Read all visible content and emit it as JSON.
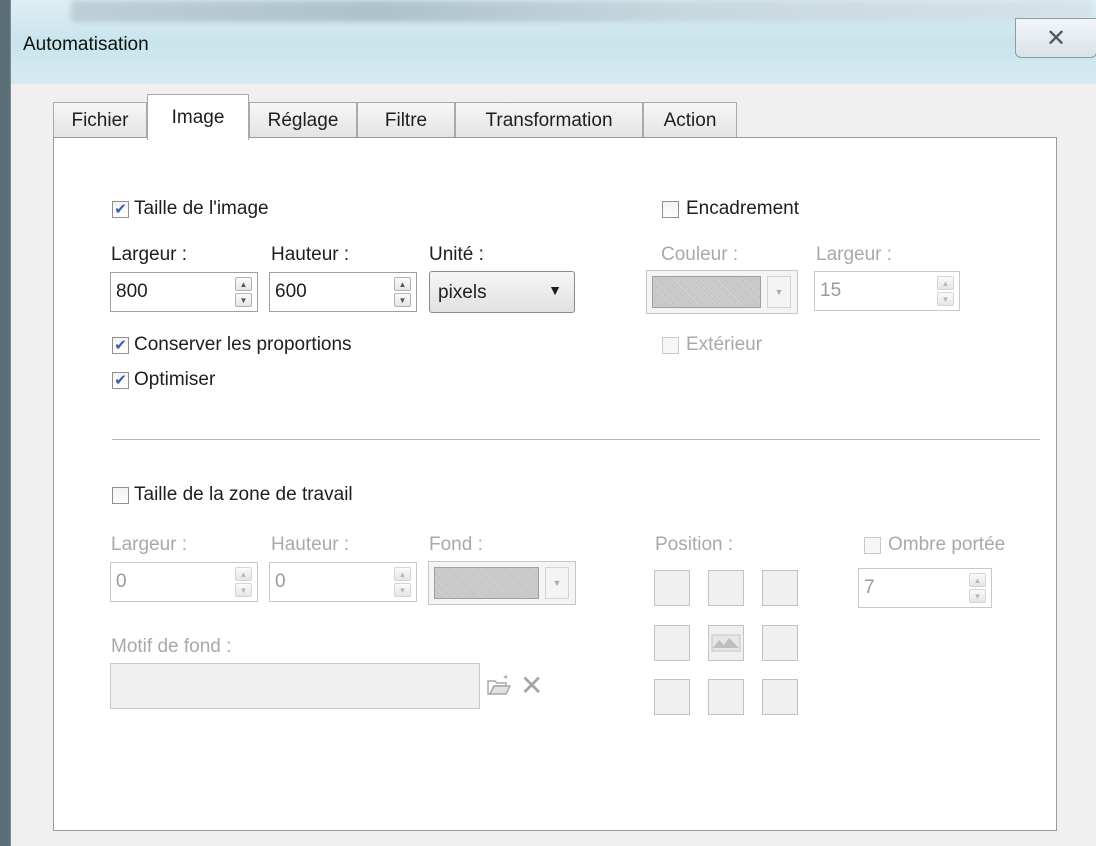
{
  "window": {
    "title": "Automatisation",
    "close_glyph": "✕"
  },
  "tabs": [
    {
      "label": "Fichier"
    },
    {
      "label": "Image"
    },
    {
      "label": "Réglage"
    },
    {
      "label": "Filtre"
    },
    {
      "label": "Transformation"
    },
    {
      "label": "Action"
    }
  ],
  "active_tab": "Image",
  "image_size": {
    "label": "Taille de l'image",
    "checked": true,
    "width_label": "Largeur :",
    "width_value": "800",
    "height_label": "Hauteur :",
    "height_value": "600",
    "unit_label": "Unité :",
    "unit_value": "pixels",
    "keep_ratio_label": "Conserver les proportions",
    "keep_ratio_checked": true,
    "optimize_label": "Optimiser",
    "optimize_checked": true
  },
  "frame": {
    "label": "Encadrement",
    "checked": false,
    "color_label": "Couleur :",
    "width_label": "Largeur :",
    "width_value": "15",
    "outside_label": "Extérieur",
    "outside_checked": false
  },
  "canvas_size": {
    "label": "Taille de la zone de travail",
    "checked": false,
    "width_label": "Largeur :",
    "width_value": "0",
    "height_label": "Hauteur :",
    "height_value": "0",
    "background_label": "Fond :",
    "pattern_label": "Motif de fond :",
    "pattern_value": "",
    "position_label": "Position :"
  },
  "shadow": {
    "label": "Ombre portée",
    "checked": false,
    "value": "7"
  },
  "icons": {
    "close": "close-icon",
    "checkmark": "checkmark-icon",
    "spin_up": "▲",
    "spin_down": "▼",
    "dropdown": "▼",
    "open_folder": "folder-open-icon",
    "clear": "✕"
  },
  "colors": {
    "accent_check": "#3a5ea8",
    "disabled_text": "#a9a9a9"
  }
}
